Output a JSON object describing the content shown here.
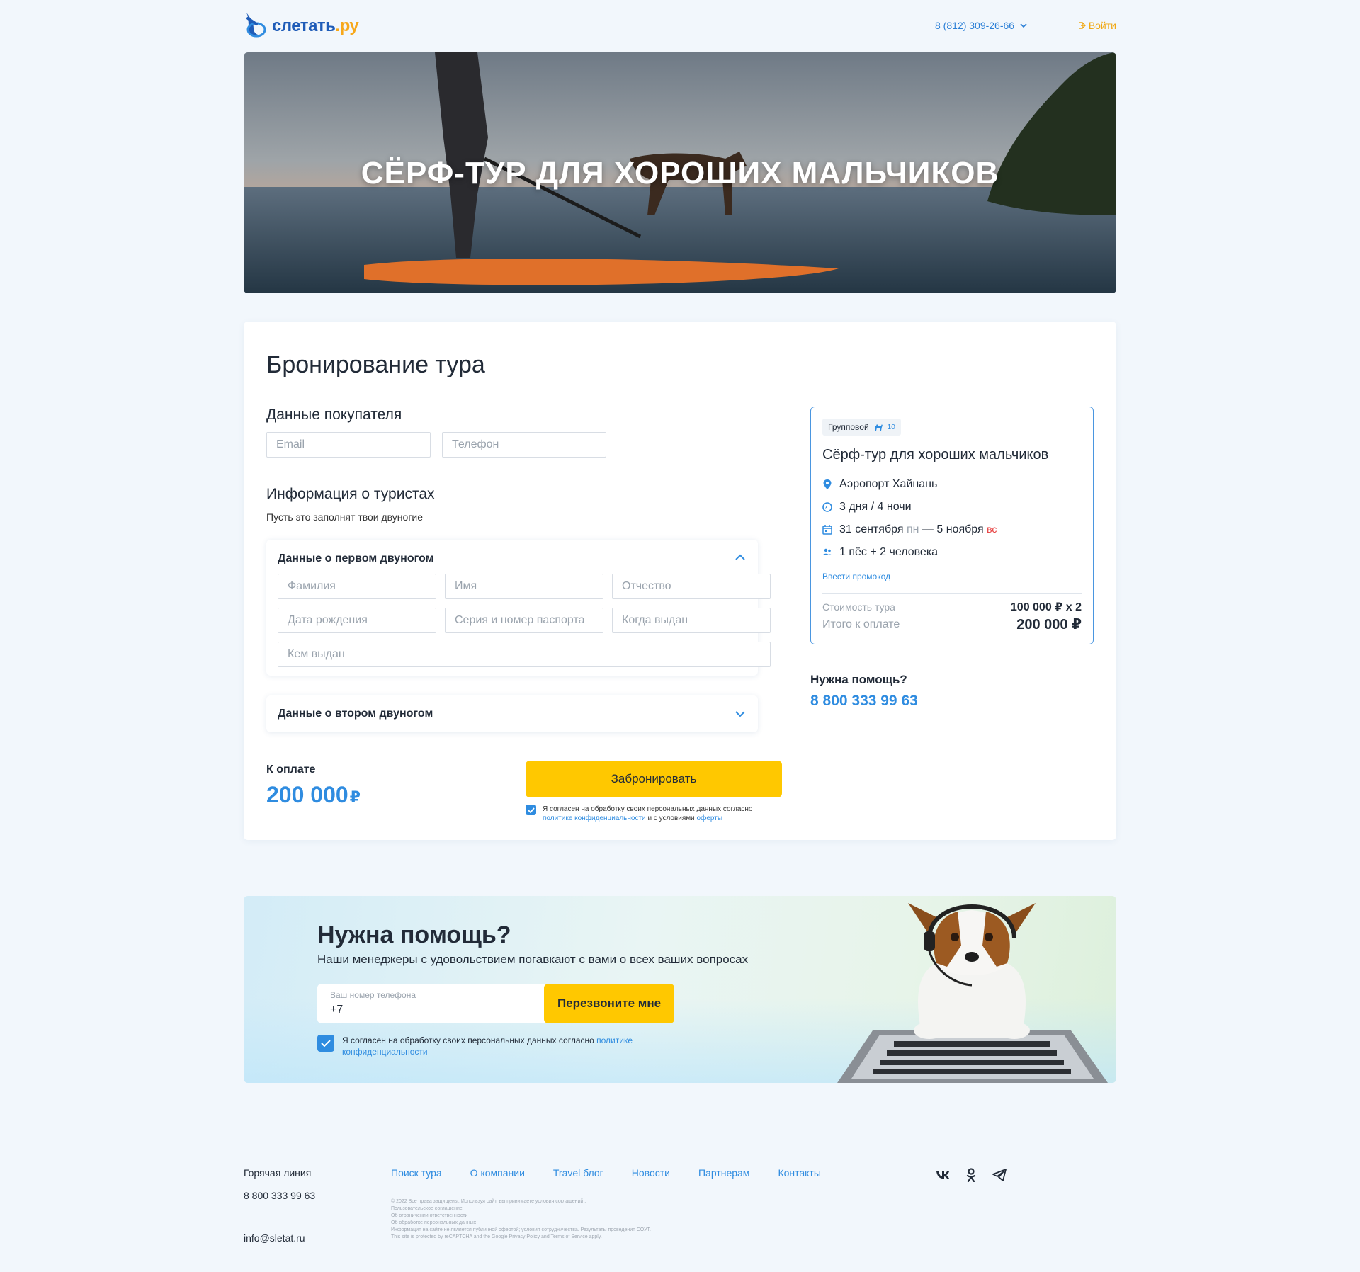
{
  "header": {
    "logo_text": "слетать",
    "logo_suffix": ".ру",
    "phone": "8 (812) 309-26-66",
    "login": "Войти"
  },
  "hero": {
    "title": "СЁРФ-ТУР ДЛЯ ХОРОШИХ МАЛЬЧИКОВ"
  },
  "booking": {
    "title": "Бронирование тура",
    "buyer_title": "Данные покупателя",
    "email_placeholder": "Email",
    "phone_placeholder": "Телефон",
    "tourists_title": "Информация о туристах",
    "tourists_note": "Пусть это заполнят твои двуногие",
    "first_person": {
      "title": "Данные о первом двуногом",
      "fields": {
        "surname": "Фамилия",
        "name": "Имя",
        "patronymic": "Отчество",
        "birth": "Дата рождения",
        "passport": "Серия и номер паспорта",
        "issued_date": "Когда выдан",
        "issued_by": "Кем выдан"
      }
    },
    "second_person": {
      "title": "Данные о втором двуногом"
    },
    "pay_label": "К оплате",
    "pay_amount": "200 000",
    "currency": "₽",
    "book_button": "Забронировать",
    "consent_text": "Я согласен на обработку своих персональных данных согласно",
    "consent_link1": "политике конфиденциальности",
    "consent_mid": "и с условиями",
    "consent_link2": "оферты"
  },
  "summary": {
    "badge": "Групповой",
    "badge_count": "10",
    "title": "Сёрф-тур для хороших мальчиков",
    "location": "Аэропорт Хайнань",
    "duration": "3 дня / 4 ночи",
    "date_from": "31 сентября",
    "day_from": "пн",
    "dash": "—",
    "date_to": "5 ноября",
    "day_to": "вс",
    "travelers": "1 пёс + 2 человека",
    "promo": "Ввести промокод",
    "cost_label": "Стоимость тура",
    "cost_value": "100 000 ₽ x 2",
    "total_label": "Итого к оплате",
    "total_value": "200 000 ₽"
  },
  "help_side": {
    "question": "Нужна помощь?",
    "phone": "8 800 333 99 63"
  },
  "banner": {
    "title": "Нужна помощь?",
    "subtitle": "Наши менеджеры с удовольствием погавкают с вами о всех ваших вопросах",
    "phone_label": "Ваш номер телефона",
    "phone_value": "+7",
    "callback_button": "Перезвоните мне",
    "consent_text": "Я согласен на обработку своих персональных данных согласно",
    "consent_link": "политике конфиденциальности"
  },
  "footer": {
    "hotline_label": "Горячая линия",
    "hotline_phone": "8 800 333 99 63",
    "email": "info@sletat.ru",
    "nav": [
      "Поиск тура",
      "О компании",
      "Travel блог",
      "Новости",
      "Партнерам",
      "Контакты"
    ],
    "legal": [
      "© 2022 Все права защищены. Используя сайт, вы принимаете условия соглашений :",
      "Пользовательское соглашение",
      "Об ограничении ответственности",
      "Об обработке персональных данных",
      "Информация на сайте не является публичной офертой; условия сотрудничества. Результаты проведения СОУТ.",
      "This site is protected by reCAPTCHA and the Google Privacy Policy and Terms of Service apply."
    ],
    "social": [
      "vk-icon",
      "ok-icon",
      "telegram-icon"
    ]
  },
  "colors": {
    "accent_blue": "#2f8ce0",
    "accent_yellow": "#ffc800",
    "background": "#f2f7fc"
  }
}
